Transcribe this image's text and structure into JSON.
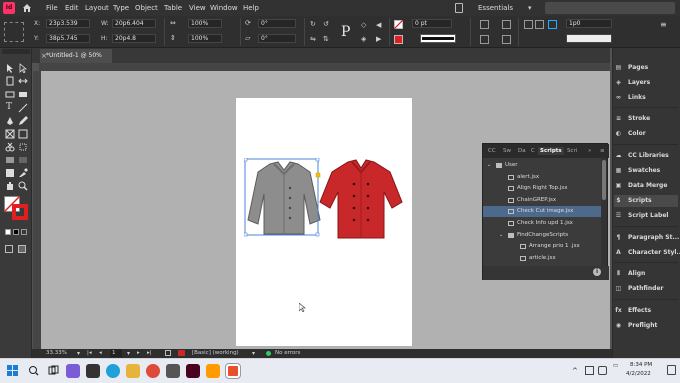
{
  "menubar": {
    "app_logo": "Id",
    "items": [
      "File",
      "Edit",
      "Layout",
      "Type",
      "Object",
      "Table",
      "View",
      "Window",
      "Help"
    ],
    "workspace": "Essentials Classic"
  },
  "control": {
    "x_label": "X:",
    "x_value": "23p3.539",
    "y_label": "Y:",
    "y_value": "38p5.745",
    "w_label": "W:",
    "w_value": "20p6.404",
    "h_label": "H:",
    "h_value": "20p4.8",
    "scale_x": "100%",
    "scale_y": "100%",
    "angle": "0°",
    "shear": "0°",
    "stroke_weight": "0 pt",
    "pt_value": "1p0",
    "opacity": "100%"
  },
  "document": {
    "tab_title": "*Untitled-1 @ 50%"
  },
  "scripts_panel": {
    "tabs": [
      "CC",
      "Sw",
      "Da",
      "C",
      "Scripts",
      "Scri"
    ],
    "rows": [
      {
        "label": "User",
        "kind": "folder",
        "indent": 0
      },
      {
        "label": "alert.jsx",
        "kind": "file",
        "indent": 1
      },
      {
        "label": "Align Right Top.jsx",
        "kind": "file",
        "indent": 1
      },
      {
        "label": "ChainGREP.jsx",
        "kind": "file",
        "indent": 1
      },
      {
        "label": "Check Cut image.jsx",
        "kind": "file",
        "indent": 1,
        "selected": true
      },
      {
        "label": "Check Info upd 1.jsx",
        "kind": "file",
        "indent": 1
      },
      {
        "label": "FindChangeScripts",
        "kind": "folder",
        "indent": 1
      },
      {
        "label": "Arrange prio 1 .jsx",
        "kind": "file",
        "indent": 2
      },
      {
        "label": "article.jsx",
        "kind": "file",
        "indent": 2
      }
    ]
  },
  "dock": {
    "items": [
      "Pages",
      "Layers",
      "Links",
      "Stroke",
      "Color",
      "CC Libraries",
      "Swatches",
      "Data Merge",
      "Scripts",
      "Script Label",
      "Paragraph St...",
      "Character Styl...",
      "Align",
      "Pathfinder",
      "Effects",
      "Preflight"
    ],
    "selected": "Scripts"
  },
  "statusbar": {
    "zoom": "33.33%",
    "page": "1",
    "style": "[Basic] (working)",
    "preflight": "No errors"
  },
  "taskbar": {
    "time": "8:34 PM",
    "date": "4/2/2022"
  },
  "colors": {
    "accent": "#4d6a8c",
    "jacket_gray": "#8a8a8a",
    "jacket_red": "#c8282a",
    "indesign_pink": "#ff3366"
  }
}
